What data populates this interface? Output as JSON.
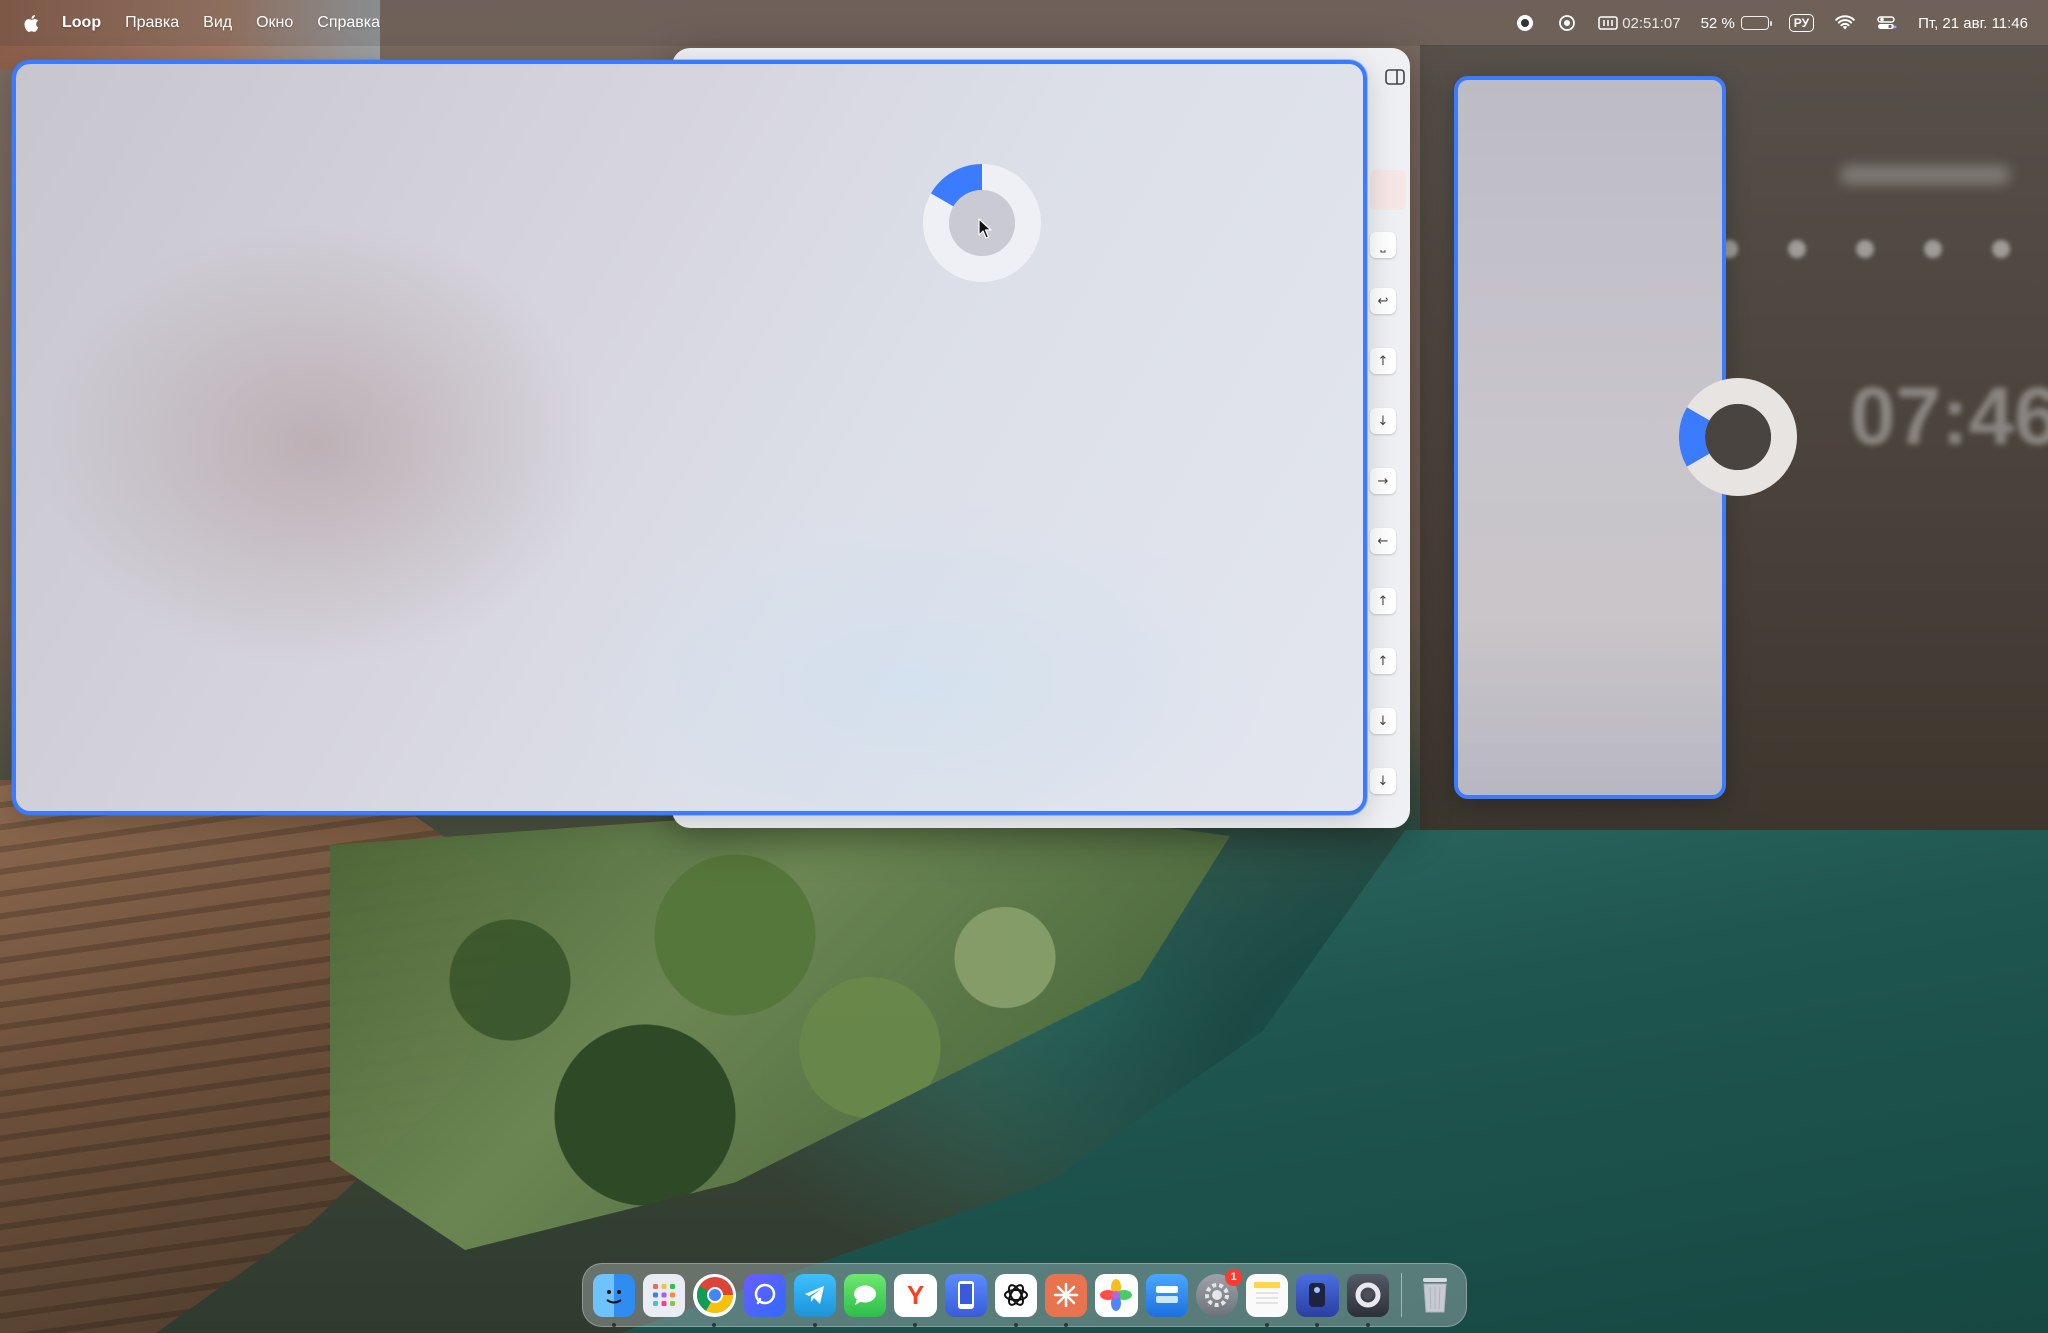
{
  "menubar": {
    "apple_icon": "apple-logo-icon",
    "app_name": "Loop",
    "items": [
      "Правка",
      "Вид",
      "Окно",
      "Справка"
    ],
    "status": {
      "timer": "02:51:07",
      "battery_percent": "52 %",
      "battery_level": 0.52,
      "input_language": "РУ",
      "datetime": "Пт, 21 авг.  11:46"
    }
  },
  "background_app": {
    "sidebar_keys": [
      "⎵",
      "↩",
      "↑",
      "↓",
      "→",
      "←",
      "↑",
      "↑",
      "↓",
      "↓"
    ]
  },
  "right_window": {
    "clock": "07:46"
  },
  "loop_overlay": {
    "accent_color": "#3a7bff"
  },
  "dock": {
    "apps": [
      {
        "name": "Finder",
        "icon": "finder-icon",
        "running": true
      },
      {
        "name": "Launchpad",
        "icon": "launchpad-icon",
        "running": false
      },
      {
        "name": "Google Chrome",
        "icon": "chrome-icon",
        "running": true
      },
      {
        "name": "Messenger",
        "icon": "messenger-icon",
        "running": false
      },
      {
        "name": "Telegram",
        "icon": "telegram-icon",
        "running": true
      },
      {
        "name": "Messages",
        "icon": "messages-icon",
        "running": false
      },
      {
        "name": "Yandex Browser",
        "icon": "yandex-icon",
        "running": true
      },
      {
        "name": "Simulator",
        "icon": "simulator-icon",
        "running": false
      },
      {
        "name": "ChatGPT",
        "icon": "chatgpt-icon",
        "running": true
      },
      {
        "name": "Claude",
        "icon": "claude-icon",
        "running": true
      },
      {
        "name": "Photos",
        "icon": "photos-icon",
        "running": false
      },
      {
        "name": "Network Radar",
        "icon": "network-icon",
        "running": false
      },
      {
        "name": "System Settings",
        "icon": "settings-icon",
        "running": false,
        "badge": "1"
      },
      {
        "name": "Notes",
        "icon": "notes-icon",
        "running": true
      },
      {
        "name": "Hardware",
        "icon": "hardware-icon",
        "running": true
      },
      {
        "name": "Loop",
        "icon": "loop-icon",
        "running": true
      }
    ],
    "trash_icon": "trash-icon"
  }
}
